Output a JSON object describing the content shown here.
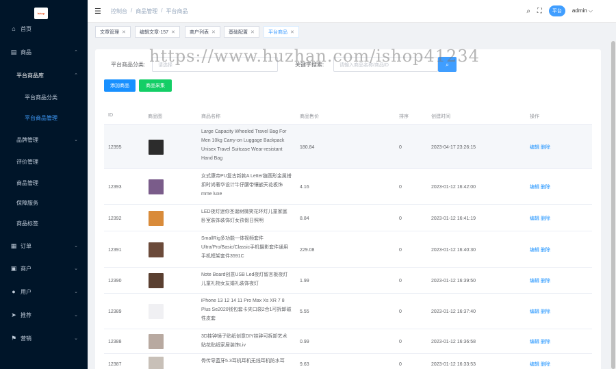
{
  "logo": {
    "text": "Ishop"
  },
  "sidebar": {
    "items": [
      {
        "icon": "home-icon",
        "glyph": "⌂",
        "label": "首页",
        "arrow": ""
      },
      {
        "icon": "shop-icon",
        "glyph": "▤",
        "label": "商品",
        "arrow": "^"
      },
      {
        "label": "平台商品库",
        "arrow": "^"
      },
      {
        "label": "平台商品分类"
      },
      {
        "label": "平台商品管理"
      },
      {
        "label": "品牌管理",
        "arrow": "v"
      },
      {
        "label": "评价管理"
      },
      {
        "label": "商品管理"
      },
      {
        "label": "保障服务"
      },
      {
        "label": "商品标签"
      },
      {
        "icon": "order-icon",
        "glyph": "▦",
        "label": "订单",
        "arrow": "v"
      },
      {
        "icon": "merchant-icon",
        "glyph": "▣",
        "label": "商户",
        "arrow": "v"
      },
      {
        "icon": "user-icon",
        "glyph": "●",
        "label": "用户",
        "arrow": "v"
      },
      {
        "icon": "promotion-icon",
        "glyph": "➤",
        "label": "推荐",
        "arrow": "v"
      },
      {
        "icon": "marketing-icon",
        "glyph": "⚑",
        "label": "营销",
        "arrow": "v"
      }
    ]
  },
  "topbar": {
    "breadcrumb": [
      "控制台",
      "/",
      "商品管理",
      "/",
      "平台商品"
    ],
    "badge": "平台",
    "user": "admin ⌵"
  },
  "tags": [
    {
      "label": "文章管理"
    },
    {
      "label": "编辑文章-157"
    },
    {
      "label": "商户列表"
    },
    {
      "label": "基础配置"
    },
    {
      "label": "平台商品"
    }
  ],
  "filters": {
    "category_label": "平台商品分类:",
    "category_placeholder": "请选择",
    "keyword_label": "关键字搜索:",
    "keyword_placeholder": "请输入商品名称/商品ID"
  },
  "buttons": {
    "add": "添加商品",
    "collect": "商品采集"
  },
  "watermark": "https://www.huzhan.com/ishop41234",
  "table": {
    "headers": [
      "ID",
      "商品图",
      "商品名称",
      "商品售价",
      "排序",
      "创建时间",
      "操作"
    ],
    "rows": [
      {
        "id": "12395",
        "name": "Large Capacity Wheeled Travel Bag For Men 10kg Carry-on Luggage Backpack Unisex Travel Suitcase Wear-resistant Hand Bag",
        "price": "180.84",
        "sort": "0",
        "time": "2023-04-17 23:26:15",
        "thumb": "#2c2c2c"
      },
      {
        "id": "12393",
        "name": "女式康帝PU复古新款A Letter链圆形金属搭扣时尚奢华设计牛仔腰带镶嵌天花板饰mme luxe",
        "price": "4.16",
        "sort": "0",
        "time": "2023-01-12 16:42:00",
        "thumb": "#7a5c8a"
      },
      {
        "id": "12392",
        "name": "LED夜灯迷你圣诞树微笑花环灯儿童家庭卧室装饰装饰灯女孩假日照明",
        "price": "8.84",
        "sort": "0",
        "time": "2023-01-12 16:41:19",
        "thumb": "#d98b3a"
      },
      {
        "id": "12391",
        "name": "SmallRig多功能一体视频套件Ultra/Pro/Basic/Classic手机摄影套件通用手机框架套件3591C",
        "price": "229.08",
        "sort": "0",
        "time": "2023-01-12 16:40:30",
        "thumb": "#6b4a3a"
      },
      {
        "id": "12390",
        "name": "Note Board创意USB Led夜灯留言板夜灯儿童礼物女友婚礼装饰夜灯",
        "price": "1.99",
        "sort": "0",
        "time": "2023-01-12 16:39:50",
        "thumb": "#5a3f30"
      },
      {
        "id": "12389",
        "name": "iPhone 13 12 14 11 Pro Max Xs XR 7 8 Plus Se2020钱包套卡夹口袋2合1可拆卸磁性皮套",
        "price": "5.55",
        "sort": "0",
        "time": "2023-01-12 16:37:40",
        "thumb": "#f0f0f3"
      },
      {
        "id": "12388",
        "name": "3D挂钟镜子贴纸创意DIY挂钟可拆卸艺术贴花贴纸家居装饰Liv",
        "price": "0.99",
        "sort": "0",
        "time": "2023-01-12 16:36:58",
        "thumb": "#b8a9a0"
      },
      {
        "id": "12387",
        "name": "骨传导蓝牙5.3耳机耳机无线耳机防水耳",
        "price": "9.63",
        "sort": "0",
        "time": "2023-01-12 16:33:53",
        "thumb": "#c8c0b8"
      }
    ],
    "ops": {
      "edit": "编辑",
      "del": "删除"
    }
  }
}
